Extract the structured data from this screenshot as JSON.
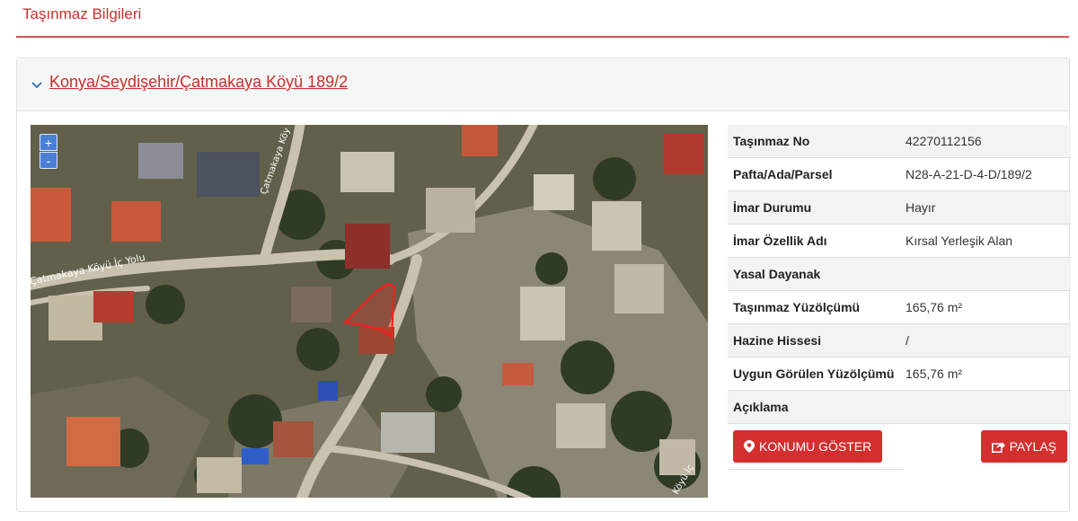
{
  "page": {
    "title": "Taşınmaz Bilgileri"
  },
  "property": {
    "link_text": "Konya/Seydişehir/Çatmakaya Köyü 189/2",
    "map": {
      "zoom_in": "+",
      "zoom_out": "-",
      "road_labels": [
        "Çatmakaya Köy",
        "Çatmakaya Köyü İç Yolu",
        "Köyü İç"
      ]
    },
    "details": [
      {
        "label": "Taşınmaz No",
        "value": "42270112156"
      },
      {
        "label": "Pafta/Ada/Parsel",
        "value": "N28-A-21-D-4-D/189/2"
      },
      {
        "label": "İmar Durumu",
        "value": "Hayır"
      },
      {
        "label": "İmar Özellik Adı",
        "value": "Kırsal Yerleşik Alan"
      },
      {
        "label": "Yasal Dayanak",
        "value": ""
      },
      {
        "label": "Taşınmaz Yüzölçümü",
        "value": "165,76 m²"
      },
      {
        "label": "Hazine Hissesi",
        "value": "/"
      },
      {
        "label": "Uygun Görülen Yüzölçümü",
        "value": "165,76 m²"
      },
      {
        "label": "Açıklama",
        "value": ""
      }
    ],
    "buttons": {
      "show_location": "KONUMU GÖSTER",
      "share": "PAYLAŞ"
    },
    "colors": {
      "accent": "#d42f2f",
      "parcel_outline": "#ff1a1a"
    }
  }
}
